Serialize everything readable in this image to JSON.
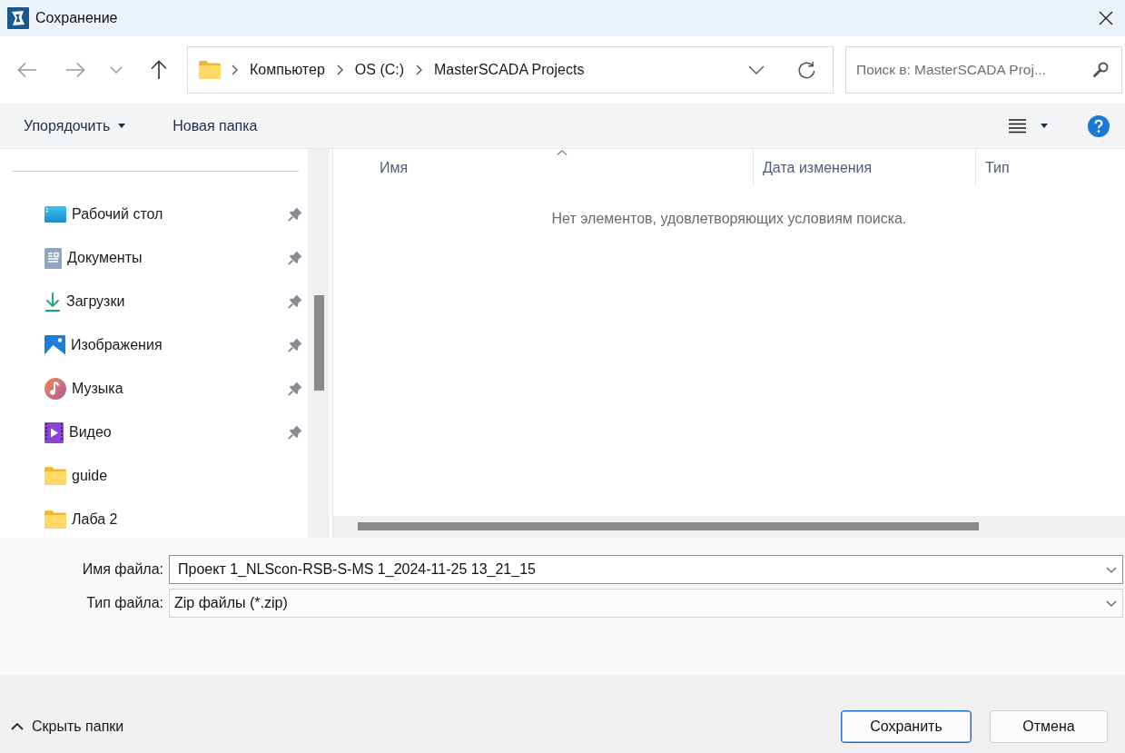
{
  "window": {
    "title": "Сохранение"
  },
  "navigation": {
    "buttons": [
      {
        "kind": "back",
        "disabled": true
      },
      {
        "kind": "forward",
        "disabled": true
      },
      {
        "kind": "recent",
        "disabled": true
      },
      {
        "kind": "up",
        "disabled": false
      }
    ],
    "breadcrumbs": [
      "Компьютер",
      "OS (C:)",
      "MasterSCADA Projects"
    ],
    "search": {
      "placeholder": "Поиск в: MasterSCADA Proj..."
    }
  },
  "toolbar": {
    "organize": "Упорядочить",
    "new_folder": "Новая папка"
  },
  "sidebar": {
    "items": [
      {
        "label": "Рабочий стол",
        "kind": "desktop",
        "pinned": true
      },
      {
        "label": "Документы",
        "kind": "documents",
        "pinned": true
      },
      {
        "label": "Загрузки",
        "kind": "downloads",
        "pinned": true
      },
      {
        "label": "Изображения",
        "kind": "pictures",
        "pinned": true
      },
      {
        "label": "Музыка",
        "kind": "music",
        "pinned": true
      },
      {
        "label": "Видео",
        "kind": "videos",
        "pinned": true
      },
      {
        "label": "guide",
        "kind": "folder",
        "pinned": false
      },
      {
        "label": "Лаба 2",
        "kind": "folder",
        "pinned": false
      }
    ]
  },
  "file_list": {
    "columns": [
      {
        "label": "Имя",
        "sorted": true
      },
      {
        "label": "Дата изменения",
        "sorted": false
      },
      {
        "label": "Тип",
        "sorted": false
      }
    ],
    "empty_message": "Нет элементов, удовлетворяющих условиям поиска."
  },
  "form": {
    "fields": [
      {
        "label": "Имя файла:",
        "kind": "input",
        "value": "Проект 1_NLScon-RSB-S-MS 1_2024-11-25 13_21_15"
      },
      {
        "label": "Тип файла:",
        "kind": "select",
        "value": "Zip файлы (*.zip)"
      }
    ]
  },
  "footer": {
    "toggle": "Скрыть папки",
    "buttons": [
      {
        "label": "Сохранить",
        "default": true
      },
      {
        "label": "Отмена",
        "default": false
      }
    ]
  }
}
